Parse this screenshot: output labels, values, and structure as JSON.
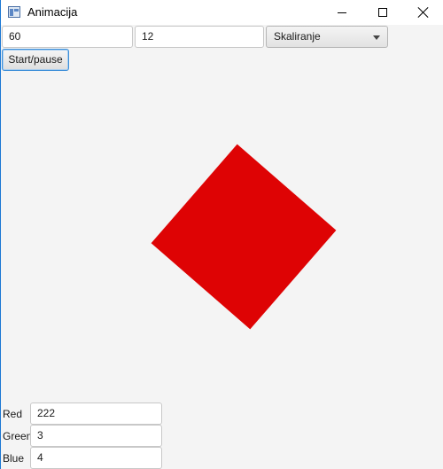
{
  "window": {
    "title": "Animacija"
  },
  "toolbar": {
    "fps_value": "60",
    "step_value": "12",
    "mode_selected": "Skaliranje",
    "start_pause_label": "Start/pause"
  },
  "shape": {
    "fill_color": "#de0304"
  },
  "colors": {
    "red_label": "Red",
    "red_value": "222",
    "green_label": "Green",
    "green_value": "3",
    "blue_label": "Blue",
    "blue_value": "4"
  }
}
